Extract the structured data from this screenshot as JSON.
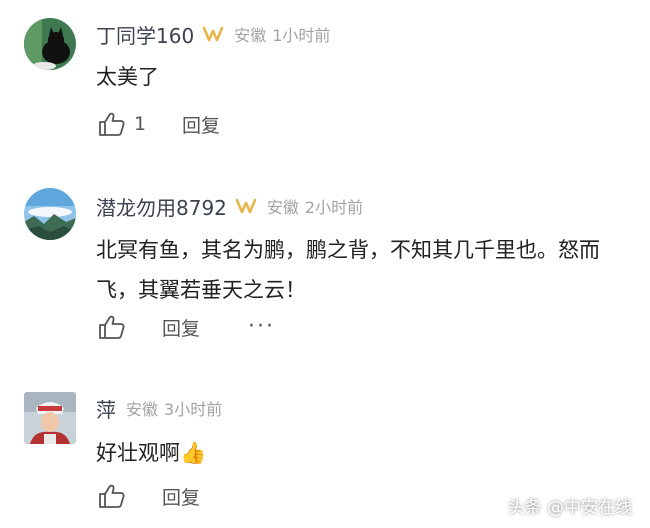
{
  "comments": [
    {
      "username": "丁同学160",
      "badge_icon": "gold-fan-badge-icon",
      "location": "安徽",
      "time": "1小时前",
      "text": "太美了",
      "like_count": "1",
      "reply_label": "回复",
      "avatar_icon": "dark-cat-avatar"
    },
    {
      "username": "潜龙勿用8792",
      "badge_icon": "gold-fan-badge-icon",
      "location": "安徽",
      "time": "2小时前",
      "text": "北冥有鱼，其名为鹏，鹏之背，不知其几千里也。怒而飞，其翼若垂天之云！",
      "reply_label": "回复",
      "avatar_icon": "mountain-landscape-avatar"
    },
    {
      "username": "萍",
      "location": "安徽",
      "time": "3小时前",
      "text": "好壮观啊",
      "emoji": "👍",
      "reply_label": "回复",
      "avatar_icon": "person-photo-avatar"
    }
  ],
  "watermark": "头条 @中安在线",
  "colors": {
    "username": "#3c4250",
    "meta": "#a3a3a3",
    "text": "#222222",
    "badge": "#e8b34a"
  }
}
